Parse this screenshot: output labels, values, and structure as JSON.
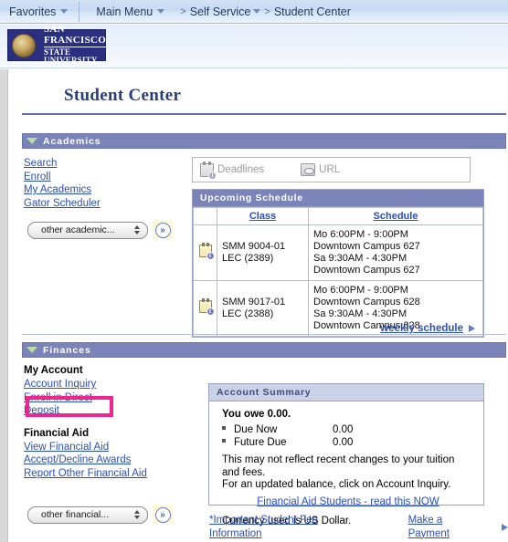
{
  "topnav": {
    "favorites": "Favorites",
    "main_menu": "Main Menu",
    "breadcrumb": [
      "Self Service",
      "Student Center"
    ],
    "crumb_sep": ">",
    "caret_icon": "chevron-down-icon"
  },
  "logo": {
    "line1": "SAN FRANCISCO",
    "line2": "STATE UNIVERSITY",
    "seal_icon": "university-seal-icon",
    "brand_color": "#2b2f80"
  },
  "page": {
    "title": "Student Center"
  },
  "academics": {
    "header": "Academics",
    "links": [
      "Search",
      "Enroll",
      "My Academics",
      "Gator Scheduler"
    ],
    "dropdown_value": "other academic...",
    "go_label": "»",
    "toolbar": [
      {
        "label": "Deadlines",
        "icon": "deadlines-calendar-icon"
      },
      {
        "label": "URL",
        "icon": "url-link-icon"
      }
    ],
    "schedule": {
      "caption": "Upcoming Schedule",
      "columns": [
        "",
        "Class",
        "Schedule"
      ],
      "rows": [
        {
          "icon": "calendar-info-icon",
          "class": "SMM 9004-01\nLEC (2389)",
          "class_line1": "SMM 9004-01",
          "class_line2": "LEC (2389)",
          "schedule": [
            "Mo 6:00PM - 9:00PM",
            "Downtown Campus 627",
            "Sa 9:30AM - 4:30PM",
            "Downtown Campus 627"
          ]
        },
        {
          "icon": "calendar-info-icon",
          "class_line1": "SMM 9017-01",
          "class_line2": "LEC (2388)",
          "schedule": [
            "Mo 6:00PM - 9:00PM",
            "Downtown Campus 628",
            "Sa 9:30AM - 4:30PM",
            "Downtown Campus 628"
          ]
        }
      ]
    },
    "weekly_schedule_link": "weekly schedule"
  },
  "finances": {
    "header": "Finances",
    "my_account_label": "My Account",
    "my_account_links": [
      "Account Inquiry",
      "Enroll in Direct Deposit"
    ],
    "financial_aid_label": "Financial Aid",
    "financial_aid_links": [
      "View Financial Aid",
      "Accept/Decline Awards",
      "Report Other Financial Aid"
    ],
    "dropdown_value": "other financial...",
    "go_label": "»",
    "account_summary": {
      "caption": "Account Summary",
      "owe_text": "You owe 0.00.",
      "rows": [
        {
          "label": "Due Now",
          "value": "0.00"
        },
        {
          "label": "Future Due",
          "value": "0.00"
        }
      ],
      "note_line1": "This may not reflect recent changes to your tuition and fees.",
      "note_line2": "For an updated balance, click on Account Inquiry.",
      "aid_link": "Financial Aid Students - read this NOW",
      "currency_note": "Currency used is US Dollar."
    },
    "footer_links": [
      "*Important Student Fee Information",
      "Make a Payment"
    ]
  },
  "highlight": {
    "target": "Account Inquiry",
    "color": "#f0268f"
  }
}
